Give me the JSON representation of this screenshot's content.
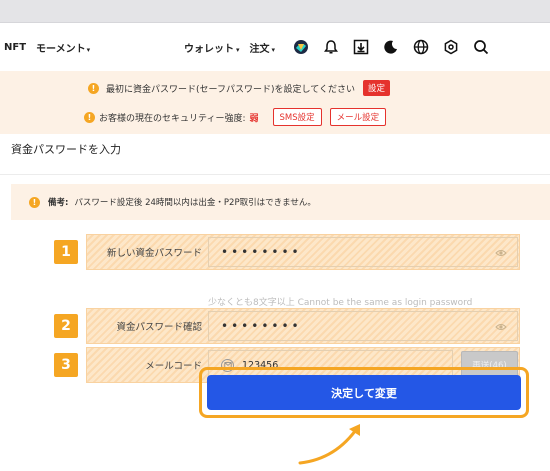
{
  "nav": {
    "nft_label": "NFT",
    "momentum_label": "モーメント",
    "wallet_label": "ウォレット",
    "order_label": "注文",
    "caret": "▾"
  },
  "banner": {
    "row1_text": "最初に資金パスワード(セーフパスワード)を設定してください",
    "row1_button": "設定",
    "row2_text": "お客様の現在のセキュリティー強度:",
    "row2_strength": "弱",
    "sms_button": "SMS設定",
    "email_button": "メール設定",
    "warn_glyph": "!"
  },
  "page": {
    "title": "資金パスワードを入力"
  },
  "note": {
    "label": "備考:",
    "text": "パスワード設定後 24時間以内は出金・P2P取引はできません。"
  },
  "form": {
    "step1": "1",
    "step2": "2",
    "step3": "3",
    "new_password_label": "新しい資金パスワード",
    "new_password_value": "••••••••",
    "confirm_password_label": "資金パスワード確認",
    "confirm_password_value": "••••••••",
    "email_code_label": "メールコード",
    "email_code_value": "123456",
    "resend_label": "再送(46)",
    "hint": "少なくとも8文字以上 Cannot be the same as login password",
    "submit_label": "決定して変更"
  },
  "colors": {
    "accent_orange": "#f5a623",
    "primary_blue": "#2457e6",
    "alert_red": "#e5322d",
    "banner_bg": "#fdf1e5"
  }
}
